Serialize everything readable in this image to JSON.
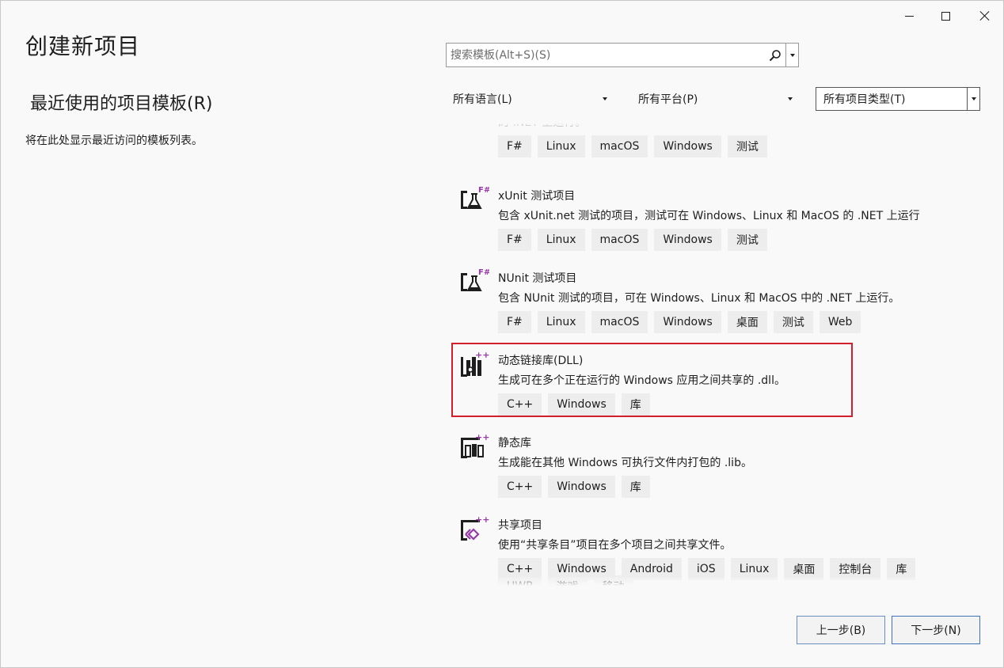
{
  "window": {
    "title": "创建新项目"
  },
  "recent": {
    "heading": "最近使用的项目模板(R)",
    "empty_text": "将在此处显示最近访问的模板列表。"
  },
  "search": {
    "placeholder": "搜索模板(Alt+S)(S)"
  },
  "filters": {
    "language": "所有语言(L)",
    "platform": "所有平台(P)",
    "project_type": "所有项目类型(T)"
  },
  "templates": [
    {
      "name": "",
      "description": "的 .NET 上运行。",
      "icon": "fsharp-console-icon",
      "tags": [
        "F#",
        "Linux",
        "macOS",
        "Windows",
        "测试"
      ]
    },
    {
      "name": "xUnit 测试项目",
      "description": "包含 xUnit.net 测试的项目，测试可在 Windows、Linux 和 MacOS 的 .NET 上运行",
      "icon": "fsharp-test-flask-icon",
      "tags": [
        "F#",
        "Linux",
        "macOS",
        "Windows",
        "测试"
      ]
    },
    {
      "name": "NUnit 测试项目",
      "description": "包含 NUnit 测试的项目，可在 Windows、Linux 和 MacOS 中的 .NET 上运行。",
      "icon": "fsharp-test-flask-icon",
      "tags": [
        "F#",
        "Linux",
        "macOS",
        "Windows",
        "桌面",
        "测试",
        "Web"
      ]
    },
    {
      "name": "动态链接库(DLL)",
      "description": "生成可在多个正在运行的 Windows 应用之间共享的 .dll。",
      "icon": "cpp-dll-icon",
      "tags": [
        "C++",
        "Windows",
        "库"
      ],
      "selected": true
    },
    {
      "name": "静态库",
      "description": "生成能在其他 Windows 可执行文件内打包的 .lib。",
      "icon": "cpp-static-lib-icon",
      "tags": [
        "C++",
        "Windows",
        "库"
      ]
    },
    {
      "name": "共享项目",
      "description": "使用“共享条目”项目在多个项目之间共享文件。",
      "icon": "cpp-shared-project-icon",
      "tags": [
        "C++",
        "Windows",
        "Android",
        "iOS",
        "Linux",
        "桌面",
        "控制台",
        "库"
      ]
    },
    {
      "name": "",
      "description": "",
      "icon": "",
      "tags": [
        "UWP",
        "游戏",
        "移动"
      ]
    }
  ],
  "buttons": {
    "back": "上一步(B)",
    "next": "下一步(N)"
  },
  "colors": {
    "selection_border": "#d21f2b",
    "fsharp_accent": "#953ba8",
    "cpp_accent": "#953ba8"
  }
}
